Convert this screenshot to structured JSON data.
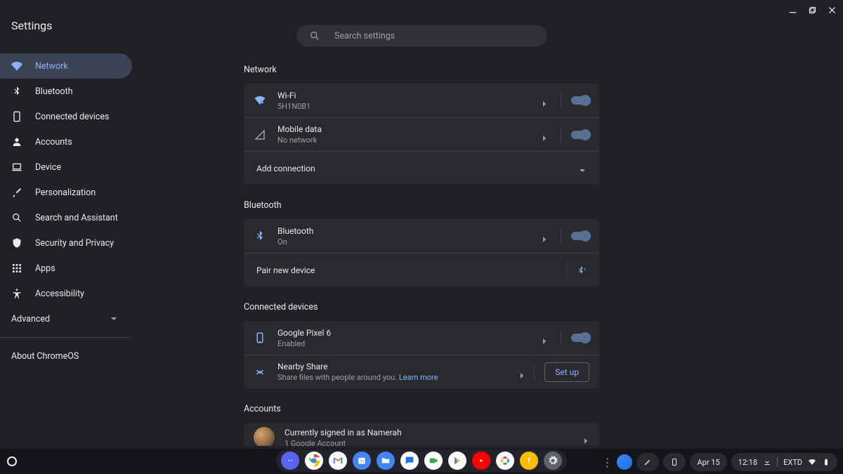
{
  "window": {
    "title": "Settings"
  },
  "search": {
    "placeholder": "Search settings"
  },
  "sidebar": {
    "items": [
      {
        "label": "Network",
        "icon": "wifi"
      },
      {
        "label": "Bluetooth",
        "icon": "bluetooth"
      },
      {
        "label": "Connected devices",
        "icon": "phone"
      },
      {
        "label": "Accounts",
        "icon": "person"
      },
      {
        "label": "Device",
        "icon": "laptop"
      },
      {
        "label": "Personalization",
        "icon": "brush"
      },
      {
        "label": "Search and Assistant",
        "icon": "search"
      },
      {
        "label": "Security and Privacy",
        "icon": "shield"
      },
      {
        "label": "Apps",
        "icon": "apps"
      },
      {
        "label": "Accessibility",
        "icon": "accessibility"
      }
    ],
    "advanced_label": "Advanced",
    "about_label": "About ChromeOS"
  },
  "sections": {
    "network": {
      "title": "Network",
      "wifi": {
        "label": "Wi-Fi",
        "sub": "5H1N0B1",
        "toggle": true
      },
      "mobile": {
        "label": "Mobile data",
        "sub": "No network",
        "toggle": true
      },
      "add": {
        "label": "Add connection"
      }
    },
    "bluetooth": {
      "title": "Bluetooth",
      "bt": {
        "label": "Bluetooth",
        "sub": "On",
        "toggle": true
      },
      "pair": {
        "label": "Pair new device"
      }
    },
    "connected": {
      "title": "Connected devices",
      "phone": {
        "label": "Google Pixel 6",
        "sub": "Enabled",
        "toggle": true
      },
      "nearby": {
        "label": "Nearby Share",
        "sub_pre": "Share files with people around you. ",
        "learn": "Learn more",
        "button": "Set up"
      }
    },
    "accounts": {
      "title": "Accounts",
      "signed_in": {
        "label": "Currently signed in as Namerah",
        "sub": "1 Google Account"
      }
    }
  },
  "shelf": {
    "dock": [
      "discord",
      "chrome",
      "gmail",
      "calendar",
      "files",
      "messages",
      "duo",
      "play",
      "youtube",
      "photos",
      "keep",
      "settings"
    ],
    "date": "Apr 15",
    "time": "12:18",
    "kbd": "EXTD"
  }
}
